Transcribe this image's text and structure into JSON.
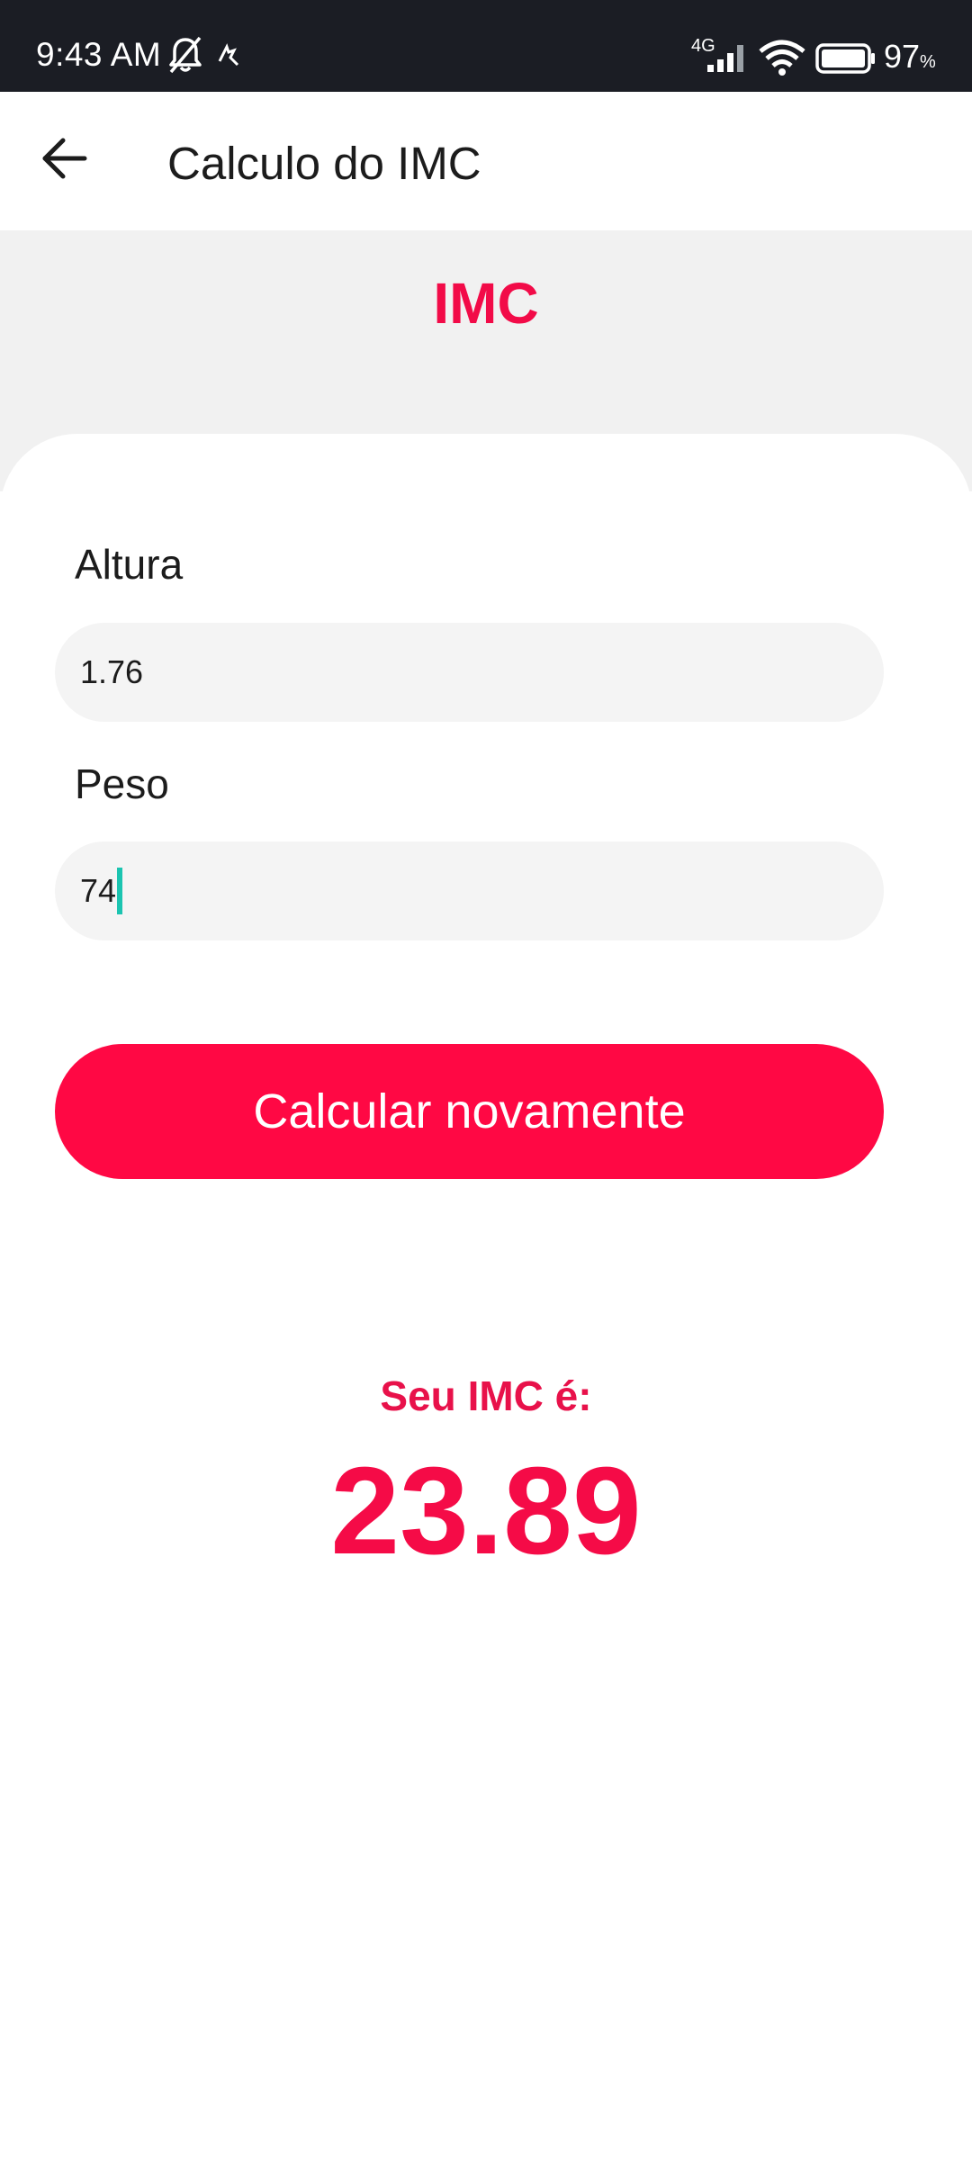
{
  "status_bar": {
    "time": "9:43 AM",
    "network": "4G",
    "battery_percent": "97",
    "battery_unit": "%",
    "icons": [
      "bell-off-icon",
      "app-notification-icon",
      "signal-icon",
      "wifi-icon",
      "battery-icon"
    ]
  },
  "app_bar": {
    "back_icon": "arrow-left-icon",
    "title": "Calculo do IMC"
  },
  "header": {
    "title": "IMC"
  },
  "form": {
    "height_label": "Altura",
    "height_value": "1.76",
    "weight_label": "Peso",
    "weight_value": "74",
    "submit_label": "Calcular novamente"
  },
  "result": {
    "label": "Seu IMC é:",
    "value": "23.89"
  },
  "colors": {
    "accent": "#ff0844",
    "accent_text": "#f20b48",
    "status_bar_bg": "#1b1d24",
    "header_bg": "#f1f1f1",
    "input_bg": "#f4f4f4",
    "caret": "#1bc4b0"
  }
}
